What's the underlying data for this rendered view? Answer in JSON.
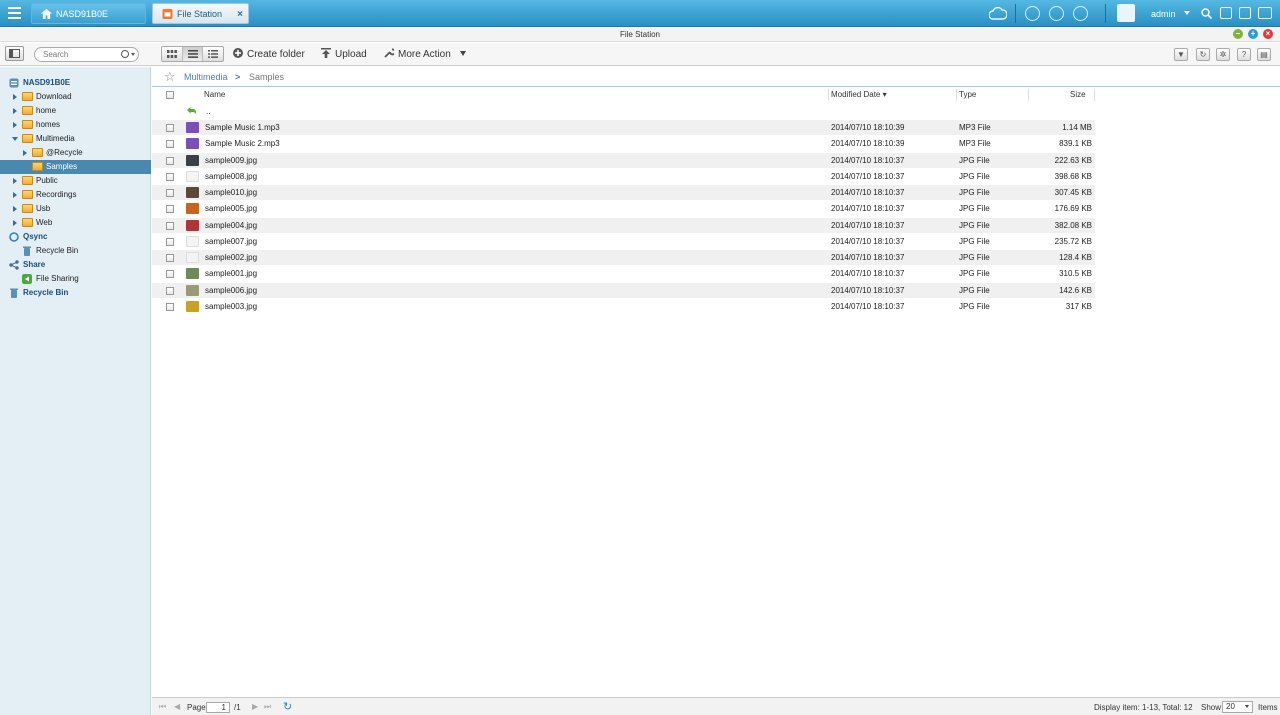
{
  "taskbar": {
    "home_tab": "NASD91B0E",
    "app_tab": "File Station",
    "close_glyph": "×",
    "user": "admin",
    "icons": [
      "menu-icon",
      "home-icon",
      "cloud-icon",
      "download-icon",
      "sync-icon",
      "info-icon",
      "user-icon",
      "search-icon",
      "help-icon",
      "grid-icon",
      "monitor-icon"
    ]
  },
  "window": {
    "title": "File Station",
    "colors": {
      "minimize": "#7bb63a",
      "maximize": "#2e9bd6",
      "close": "#e03a3a"
    }
  },
  "toolbar": {
    "search_placeholder": "Search",
    "create_folder": "Create folder",
    "upload": "Upload",
    "more_action": "More Action",
    "right_icons": [
      "filter-icon",
      "refresh-icon",
      "settings-icon",
      "help-icon",
      "panel-icon"
    ]
  },
  "sidebar": {
    "root": "NASD91B0E",
    "folders": [
      "Download",
      "home",
      "homes",
      "Multimedia",
      "@Recycle",
      "Samples",
      "Public",
      "Recordings",
      "Usb",
      "Web"
    ],
    "qsync": "Qsync",
    "qsync_recycle": "Recycle Bin",
    "share": "Share",
    "file_sharing": "File Sharing",
    "recycle_bin": "Recycle Bin",
    "selected": "Samples"
  },
  "breadcrumb": {
    "parts": [
      "Multimedia",
      "Samples"
    ],
    "separator": ">"
  },
  "table": {
    "headers": {
      "name": "Name",
      "modified": "Modified Date",
      "type": "Type",
      "size": "Size"
    },
    "sort_indicator": "▾",
    "up_row": "..",
    "rows": [
      {
        "name": "Sample Music 1.mp3",
        "date": "2014/07/10 18:10:39",
        "type": "MP3 File",
        "size": "1.14 MB",
        "thumb": "#7b4fb8"
      },
      {
        "name": "Sample Music 2.mp3",
        "date": "2014/07/10 18:10:39",
        "type": "MP3 File",
        "size": "839.1 KB",
        "thumb": "#7b4fb8"
      },
      {
        "name": "sample009.jpg",
        "date": "2014/07/10 18:10:37",
        "type": "JPG File",
        "size": "222.63 KB",
        "thumb": "#3a3f4a"
      },
      {
        "name": "sample008.jpg",
        "date": "2014/07/10 18:10:37",
        "type": "JPG File",
        "size": "398.68 KB",
        "thumb": "#f4f4f4"
      },
      {
        "name": "sample010.jpg",
        "date": "2014/07/10 18:10:37",
        "type": "JPG File",
        "size": "307.45 KB",
        "thumb": "#5a4a3a"
      },
      {
        "name": "sample005.jpg",
        "date": "2014/07/10 18:10:37",
        "type": "JPG File",
        "size": "176.69 KB",
        "thumb": "#c8641e"
      },
      {
        "name": "sample004.jpg",
        "date": "2014/07/10 18:10:37",
        "type": "JPG File",
        "size": "382.08 KB",
        "thumb": "#b0353a"
      },
      {
        "name": "sample007.jpg",
        "date": "2014/07/10 18:10:37",
        "type": "JPG File",
        "size": "235.72 KB",
        "thumb": "#f4f4f4"
      },
      {
        "name": "sample002.jpg",
        "date": "2014/07/10 18:10:37",
        "type": "JPG File",
        "size": "128.4 KB",
        "thumb": "#f4f4f4"
      },
      {
        "name": "sample001.jpg",
        "date": "2014/07/10 18:10:37",
        "type": "JPG File",
        "size": "310.5 KB",
        "thumb": "#6f8a5a"
      },
      {
        "name": "sample006.jpg",
        "date": "2014/07/10 18:10:37",
        "type": "JPG File",
        "size": "142.6 KB",
        "thumb": "#9a9a7a"
      },
      {
        "name": "sample003.jpg",
        "date": "2014/07/10 18:10:37",
        "type": "JPG File",
        "size": "317 KB",
        "thumb": "#c8a02a"
      }
    ]
  },
  "footer": {
    "page_label": "Page",
    "page_value": "1",
    "page_total": "/1",
    "display_info": "Display item: 1-13, Total: 12",
    "show_label": "Show",
    "show_value": "20",
    "items_label": "Items"
  }
}
